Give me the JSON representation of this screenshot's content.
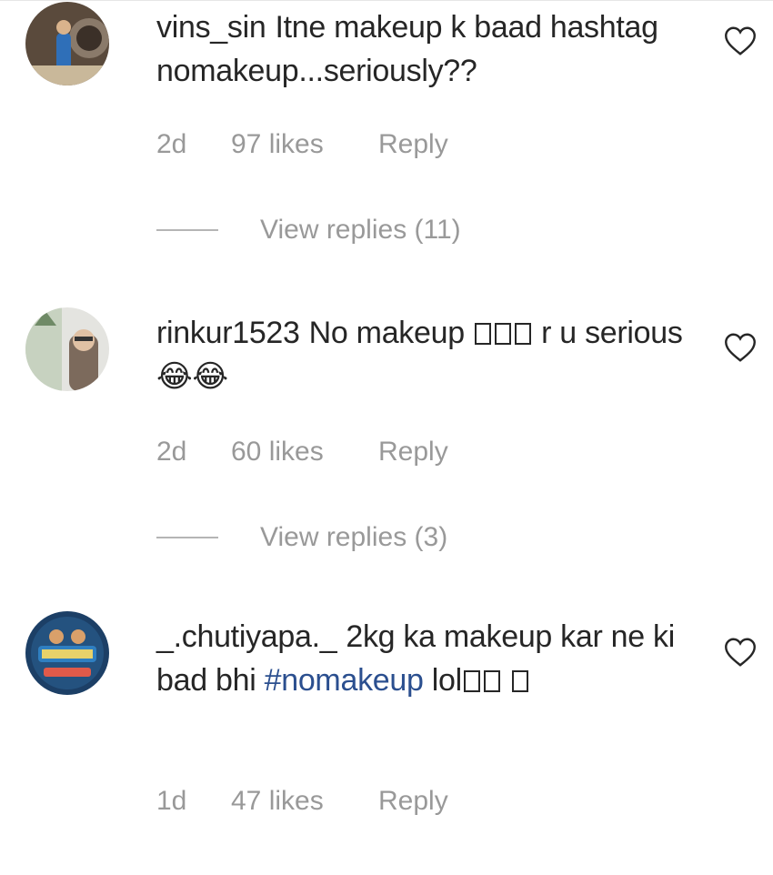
{
  "comments": [
    {
      "username": "vins_sin",
      "text_parts": [
        "Itne makeup k baad hashtag nomakeup...seriously??"
      ],
      "time": "2d",
      "likes": "97 likes",
      "reply": "Reply",
      "view_replies": "View replies (11)",
      "avatar_icon": "profile-photo"
    },
    {
      "username": "rinkur1523",
      "text_before": "No makeup",
      "text_after": "r u serious",
      "emoji_text": "😂😂",
      "time": "2d",
      "likes": "60 likes",
      "reply": "Reply",
      "view_replies": "View replies (3)",
      "avatar_icon": "profile-photo"
    },
    {
      "username": "_.chutiyapa._",
      "text_before": "2kg ka makeup kar ne ki bad bhi",
      "hashtag": "#nomakeup",
      "text_after": "lol",
      "time": "1d",
      "likes": "47 likes",
      "reply": "Reply",
      "avatar_icon": "profile-logo"
    }
  ],
  "colors": {
    "text": "#262626",
    "meta": "#999999",
    "hashtag": "#2b4f8f",
    "divider": "#b5b5b5"
  },
  "icons": {
    "like": "heart-outline-icon"
  }
}
